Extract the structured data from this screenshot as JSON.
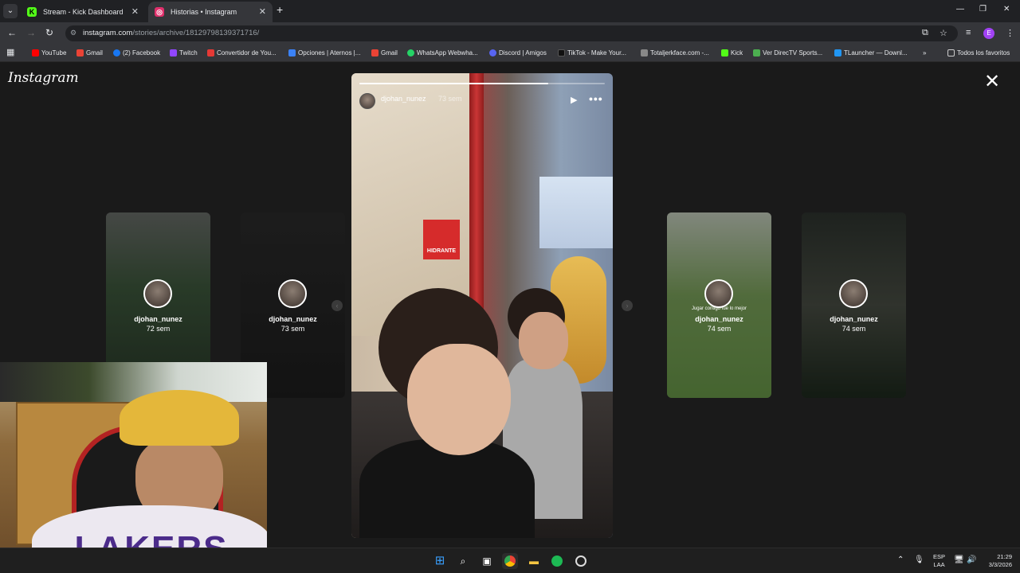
{
  "browser": {
    "tabs": [
      {
        "title": "Stream - Kick Dashboard",
        "favicon": "kick-icon",
        "color": "#53fc18"
      },
      {
        "title": "Historias • Instagram",
        "favicon": "instagram-icon",
        "color": "#e1306c"
      }
    ],
    "url_host": "instagram.com",
    "url_path": "/stories/archive/18129798139371716/"
  },
  "bookmarks": [
    {
      "label": "YouTube",
      "color": "#ff0000"
    },
    {
      "label": "Gmail",
      "color": "#ea4335"
    },
    {
      "label": "(2) Facebook",
      "color": "#1877f2"
    },
    {
      "label": "Twitch",
      "color": "#9146ff"
    },
    {
      "label": "Convertidor de You...",
      "color": "#e53935"
    },
    {
      "label": "Opciones | Aternos |...",
      "color": "#3b82f6"
    },
    {
      "label": "Gmail",
      "color": "#ea4335"
    },
    {
      "label": "WhatsApp Webwha...",
      "color": "#25d366"
    },
    {
      "label": "Discord | Amigos",
      "color": "#5865f2"
    },
    {
      "label": "TikTok - Make Your...",
      "color": "#111111"
    },
    {
      "label": "Totaljerkface.com -...",
      "color": "#888888"
    },
    {
      "label": "Kick",
      "color": "#53fc18"
    },
    {
      "label": "Ver DirecTV Sports...",
      "color": "#4caf50"
    },
    {
      "label": "TLauncher — Downl...",
      "color": "#2196f3"
    }
  ],
  "bookmarks_more": "»",
  "bookmarks_all": "Todos los favoritos",
  "instagram": {
    "logo": "Instagram",
    "main_story": {
      "username": "djohan_nunez",
      "time": "73 sem",
      "progress": 0.77,
      "sign_text": "HIDRANTE"
    },
    "side_stories": [
      {
        "username": "djohan_nunez",
        "time": "72 sem",
        "caption": ""
      },
      {
        "username": "djohan_nunez",
        "time": "73 sem",
        "caption": ""
      },
      {
        "username": "djohan_nunez",
        "time": "74 sem",
        "caption": "Jugar contigo fue lo mejor"
      },
      {
        "username": "djohan_nunez",
        "time": "74 sem",
        "caption": ""
      }
    ]
  },
  "webcam": {
    "shirt_text": "LAKERS"
  },
  "taskbar": {
    "lang_top": "ESP",
    "lang_bottom": "LAA",
    "time": "21:29",
    "date": "3/3/2026"
  }
}
